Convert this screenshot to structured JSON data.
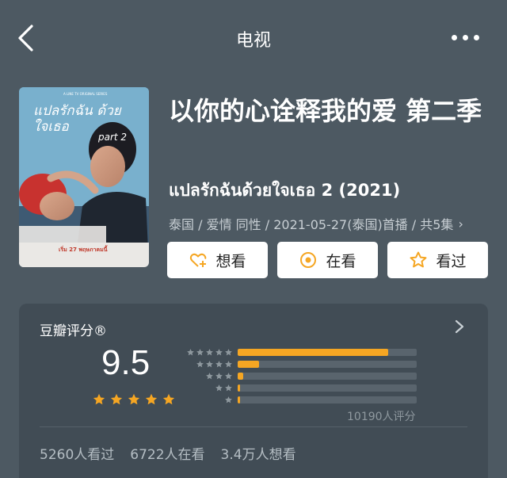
{
  "nav": {
    "title": "电视"
  },
  "movie": {
    "title": "以你的心诠释我的爱 第二季",
    "original_title": "แปลรักฉันด้วยใจเธอ 2 (2021)",
    "meta": "泰国 / 爱情 同性 / 2021-05-27(泰国)首播 / 共5集",
    "poster": {
      "tagline": "A LINE TV ORIGINAL SERIES",
      "logo_text": "แปลรักฉัน ด้วยใจเธอ",
      "part_text": "part 2",
      "date_text": "เริ่ม 27 พฤษภาคมนี้"
    }
  },
  "buttons": [
    {
      "label": "想看",
      "icon": "heart-plus-icon"
    },
    {
      "label": "在看",
      "icon": "circle-dot-icon"
    },
    {
      "label": "看过",
      "icon": "star-outline-icon"
    }
  ],
  "rating": {
    "heading": "豆瓣评分®",
    "score": "9.5",
    "star_count": 5,
    "distribution": [
      {
        "stars": 5,
        "fraction": 0.84
      },
      {
        "stars": 4,
        "fraction": 0.12
      },
      {
        "stars": 3,
        "fraction": 0.03
      },
      {
        "stars": 2,
        "fraction": 0.006
      },
      {
        "stars": 1,
        "fraction": 0.01
      }
    ],
    "count_text": "10190人评分",
    "accent_color": "#f5a623"
  },
  "stats": {
    "watched": "5260人看过",
    "watching": "6722人在看",
    "wish": "3.4万人想看"
  }
}
